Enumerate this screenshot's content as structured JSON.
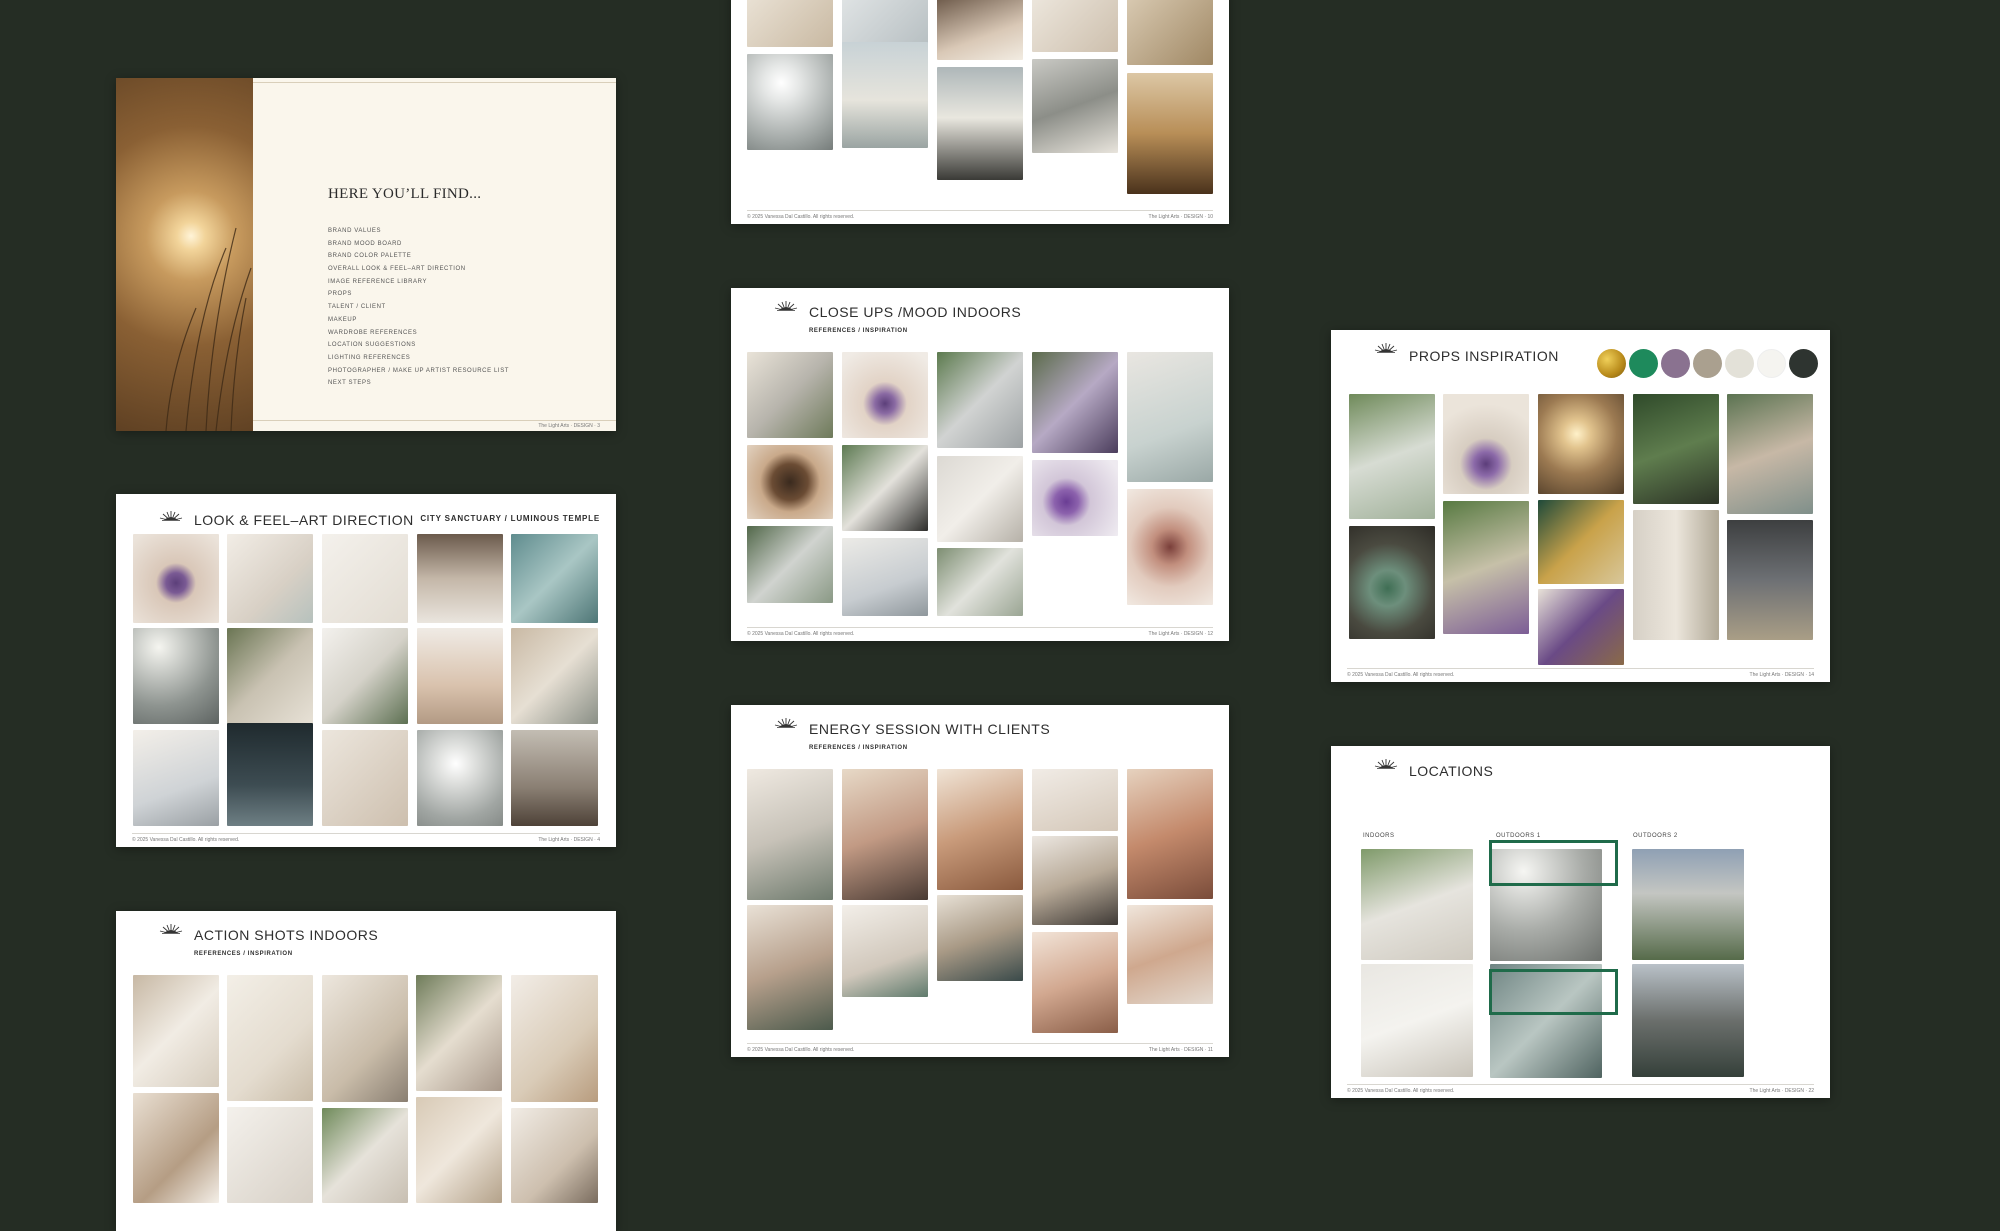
{
  "slides": {
    "toc": {
      "title": "HERE YOU’LL FIND...",
      "items": [
        "BRAND VALUES",
        "BRAND MOOD BOARD",
        "BRAND COLOR PALETTE",
        "OVERALL LOOK & FEEL–ART DIRECTION",
        "IMAGE REFERENCE LIBRARY",
        "PROPS",
        "TALENT / CLIENT",
        "MAKEUP",
        "WARDROBE REFERENCES",
        "LOCATION SUGGESTIONS",
        "LIGHTING REFERENCES",
        "PHOTOGRAPHER / MAKE UP ARTIST RESOURCE LIST",
        "NEXT STEPS"
      ],
      "footer_right": "The Light Arts · DESIGN · 3"
    },
    "top_center": {
      "footer_left": "© 2025 Vanessa Dal Castillo. All rights reserved.",
      "footer_right": "The Light Arts · DESIGN · 10"
    },
    "look_feel": {
      "title": "LOOK & FEEL–ART DIRECTION",
      "tag": "CITY SANCTUARY / LUMINOUS TEMPLE",
      "footer_left": "© 2025 Vanessa Dal Castillo. All rights reserved.",
      "footer_right": "The Light Arts · DESIGN · 4"
    },
    "close_ups": {
      "title": "CLOSE UPS /MOOD INDOORS",
      "subtitle": "REFERENCES / INSPIRATION",
      "footer_left": "© 2025 Vanessa Dal Castillo. All rights reserved.",
      "footer_right": "The Light Arts · DESIGN · 12"
    },
    "props": {
      "title": "PROPS INSPIRATION",
      "palette": [
        "#c9a227",
        "#1e8a5c",
        "#8a7290",
        "#aaa08f",
        "#e3e1d8",
        "#f5f4f0",
        "#2e3430"
      ],
      "footer_left": "© 2025 Vanessa Dal Castillo. All rights reserved.",
      "footer_right": "The Light Arts · DESIGN · 14"
    },
    "energy": {
      "title": "ENERGY SESSION WITH CLIENTS",
      "subtitle": "REFERENCES / INSPIRATION",
      "footer_left": "© 2025 Vanessa Dal Castillo. All rights reserved.",
      "footer_right": "The Light Arts · DESIGN · 11"
    },
    "locations": {
      "title": "LOCATIONS",
      "labels": [
        "INDOORS",
        "OUTDOORS 1",
        "OUTDOORS 2"
      ],
      "footer_left": "© 2025 Vanessa Dal Castillo. All rights reserved.",
      "footer_right": "The Light Arts · DESIGN · 22"
    },
    "action": {
      "title": "ACTION SHOTS INDOORS",
      "subtitle": "REFERENCES / INSPIRATION"
    }
  }
}
